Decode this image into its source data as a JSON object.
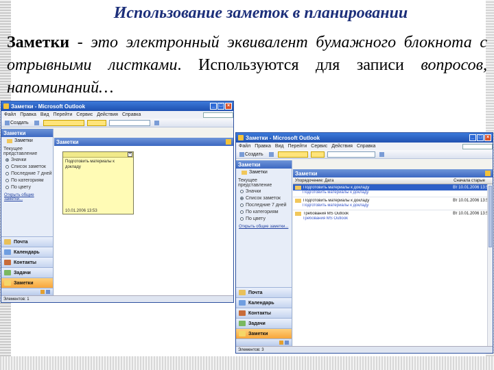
{
  "slide": {
    "title": "Использование заметок в планировании",
    "term": "Заметки",
    "text_before_italic": " - ",
    "text_italic_1": "это электронный эквивалент бумажного блокнота с отрывными листками",
    "text_mid": ". Используются для записи ",
    "text_italic_2": "вопросов, напоминаний…"
  },
  "window1": {
    "title": "Заметки - Microsoft Outlook",
    "buttons": [
      "_",
      "□",
      "×"
    ],
    "menu": [
      "Файл",
      "Правка",
      "Вид",
      "Перейти",
      "Сервис",
      "Действия",
      "Справка"
    ],
    "toolbar": {
      "new": "Создать",
      "find_value": "",
      "search_value": ""
    },
    "nav": {
      "header": "Заметки",
      "folder": "Заметки",
      "section": "Текущее представление",
      "views": [
        "Значки",
        "Список заметок",
        "Последние 7 дней",
        "По категориям",
        "По цвету"
      ],
      "link": "Открыть общие заметки..."
    },
    "nav_buttons": [
      "Почта",
      "Календарь",
      "Контакты",
      "Задачи",
      "Заметки"
    ],
    "content_header": "Заметки",
    "note": {
      "text": "Подготовить материалы к докладу",
      "date": "10.01.2006 13:53"
    },
    "status": "Элементов: 1"
  },
  "window2": {
    "title": "Заметки - Microsoft Outlook",
    "buttons": [
      "_",
      "□",
      "×"
    ],
    "menu": [
      "Файл",
      "Правка",
      "Вид",
      "Перейти",
      "Сервис",
      "Действия",
      "Справка"
    ],
    "toolbar": {
      "new": "Создать"
    },
    "nav": {
      "header": "Заметки",
      "folder": "Заметки",
      "section": "Текущее представление",
      "views": [
        "Значки",
        "Список заметок",
        "Последние 7 дней",
        "По категориям",
        "По цвету"
      ],
      "link": "Открыть общие заметки..."
    },
    "nav_buttons": [
      "Почта",
      "Календарь",
      "Контакты",
      "Задачи",
      "Заметки"
    ],
    "content_header": "Заметки",
    "columns": {
      "subject": "Упорядочение: Дата",
      "date": "Сначала старые"
    },
    "rows": [
      {
        "subject": "Подготовить материалы к докладу",
        "date": "Вт 10.01.2006 13:53",
        "selected": true,
        "preview": "Подготовить материалы к докладу"
      },
      {
        "subject": "Подготовить материалы к докладу",
        "date": "Вт 10.01.2006 13:54",
        "selected": false,
        "preview": "Подготовить материалы к докладу"
      },
      {
        "subject": "Требования MS Outlook",
        "date": "Вт 10.01.2006 13:55",
        "selected": false,
        "preview": "Требования MS Outlook"
      }
    ],
    "status": "Элементов: 3"
  },
  "colors": {
    "title_blue": "#1c2f7a",
    "outlook_header": "#3c68c2",
    "active_nav": "#f7a53b",
    "selection": "#2d5fc7",
    "note_yellow": "#fffbb5"
  }
}
